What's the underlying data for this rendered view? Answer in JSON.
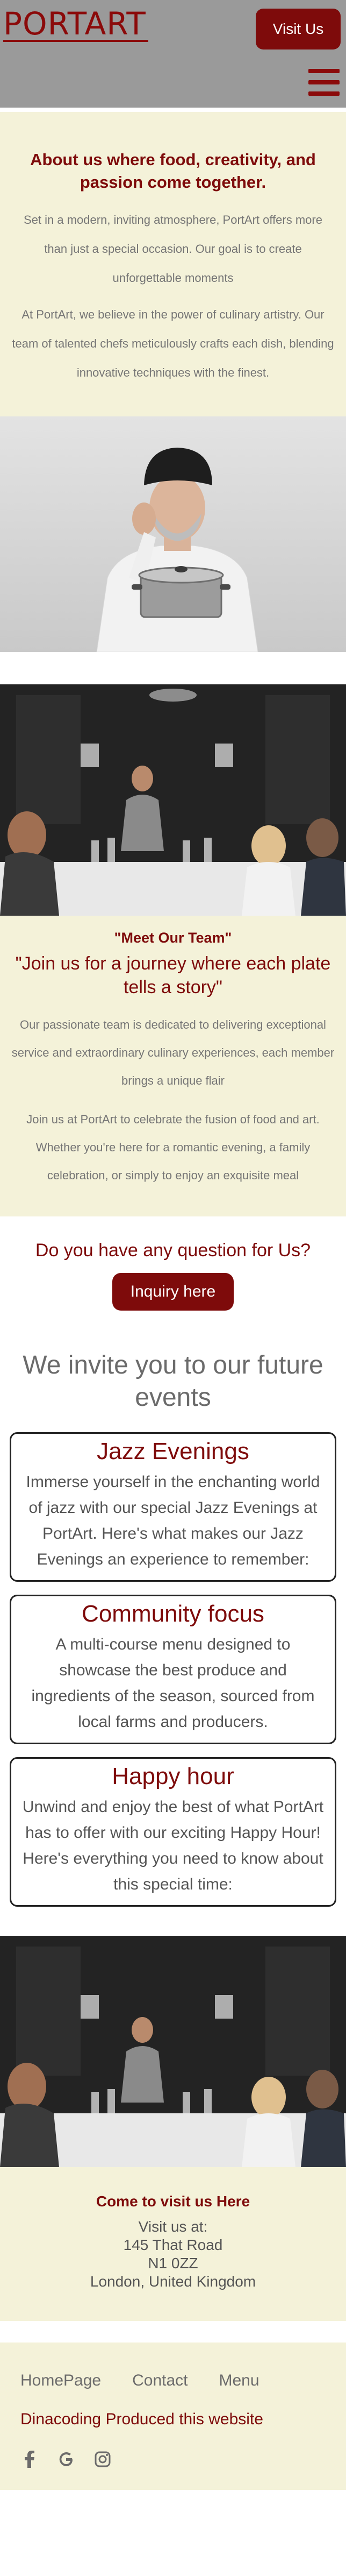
{
  "header": {
    "logo": "PORTART",
    "visit_button": "Visit Us"
  },
  "about": {
    "heading": "About us where food, creativity, and passion come together.",
    "paragraph1": "Set in a modern, inviting atmosphere, PortArt offers more than just a special occasion. Our goal is to create unforgettable moments",
    "paragraph2": "At PortArt, we believe in the power of culinary artistry. Our team of talented chefs meticulously crafts each dish, blending innovative techniques with the finest."
  },
  "team": {
    "title": "\"Meet Our Team\"",
    "subtitle": "\"Join us for a journey where each plate tells a story\"",
    "paragraph1": "Our passionate team is dedicated to delivering exceptional service and extraordinary culinary experiences, each member brings a unique flair",
    "paragraph2": "Join us at PortArt to celebrate the fusion of food and art. Whether you're here for a romantic evening, a family celebration, or simply to enjoy an exquisite meal"
  },
  "question": {
    "heading": "Do you have any question for Us?",
    "button": "Inquiry here"
  },
  "events": {
    "heading": "We invite you to our future events",
    "cards": [
      {
        "title": "Jazz Evenings",
        "text": "Immerse yourself in the enchanting world of jazz with our special Jazz Evenings at PortArt. Here's what makes our Jazz Evenings an experience to remember:"
      },
      {
        "title": "Community focus",
        "text": "A multi-course menu designed to showcase the best produce and ingredients of the season, sourced from local farms and producers."
      },
      {
        "title": "Happy hour",
        "text": "Unwind and enjoy the best of what PortArt has to offer with our exciting Happy Hour! Here's everything you need to know about this special time:"
      }
    ]
  },
  "visit": {
    "heading": "Come to visit us Here",
    "line1": "Visit us at:",
    "line2": "145 That Road",
    "line3": "N1 0ZZ",
    "line4": "London, United Kingdom"
  },
  "footer": {
    "nav": [
      "HomePage",
      "Contact",
      "Menu"
    ],
    "credit": "Dinacoding Produced this website",
    "social_icons": [
      "facebook-icon",
      "google-icon",
      "instagram-icon"
    ]
  },
  "colors": {
    "brand": "#7e0b0b",
    "cream": "#f4f2d9",
    "header_gray": "#9a9a9a"
  }
}
